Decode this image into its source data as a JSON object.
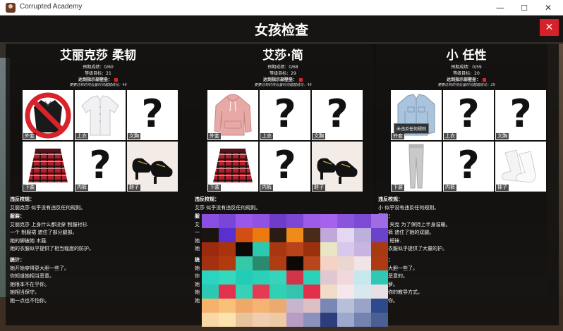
{
  "window": {
    "title": "Corrupted Academy",
    "minimize": "—",
    "maximize": "☐",
    "close": "✕"
  },
  "page": {
    "title": "女孩检查",
    "close_label": "✕"
  },
  "girls": [
    {
      "name": "艾丽克莎 柔韧",
      "stats": [
        "预期成绩：0/60",
        "等级目标：21",
        "达到指示部壁垒：",
        "要要达到的将后量时间越越结论：46"
      ],
      "slots": [
        {
          "label": "外套",
          "item": "banned-jacket",
          "question": ""
        },
        {
          "label": "上衣",
          "item": "white-shirt",
          "question": ""
        },
        {
          "label": "文胸",
          "item": "unknown",
          "question": "?"
        },
        {
          "label": "下装",
          "item": "plaid-skirt",
          "question": ""
        },
        {
          "label": "内裤",
          "item": "unknown",
          "question": "?"
        },
        {
          "label": "鞋子",
          "item": "mary-jane-shoes",
          "question": ""
        }
      ],
      "violation_title": "违反校规：",
      "violation_text": "艾丽克莎 似乎没有违反任何规则。",
      "outfit_title": "服装：",
      "outfit_lines": [
        "艾丽克莎 上身什么都没穿 制服衬衫.",
        "一个 制服裙 遮住了部分腿部。",
        "她的脚被她 木屐.",
        "她的衣服似乎提供了相当程度的防护。"
      ],
      "stats_title": "统计：",
      "stats_lines": [
        "她开始穿得更大胆一些了。",
        "你知道她相当恶意。",
        "她根本不在乎你。",
        "她相当保守。",
        "她一点也不怕你。"
      ]
    },
    {
      "name": "艾莎·简",
      "stats": [
        "预期成绩：0/68",
        "等级目标：29",
        "达到指示部壁垒：",
        "要要达到的将后量时间越越结论：46"
      ],
      "slots": [
        {
          "label": "外套",
          "item": "pink-hoodie",
          "question": ""
        },
        {
          "label": "上衣",
          "item": "unknown",
          "question": "?"
        },
        {
          "label": "文胸",
          "item": "unknown",
          "question": "?"
        },
        {
          "label": "下装",
          "item": "plaid-skirt",
          "question": ""
        },
        {
          "label": "内裤",
          "item": "unknown",
          "question": "?"
        },
        {
          "label": "鞋子",
          "item": "mary-jane-shoes",
          "question": ""
        }
      ],
      "violation_title": "违反校规：",
      "violation_text": "艾莎 似乎没有违反任何规则。",
      "outfit_title": "服",
      "outfit_lines": [
        "艾",
        "一",
        "她",
        "她"
      ],
      "stats_title": "统",
      "stats_lines": [
        "她",
        "你",
        "她",
        "她",
        "她"
      ]
    },
    {
      "name": "小 任性",
      "stats": [
        "预期成绩：0/59",
        "等级目标：20",
        "达到指示部壁垒：",
        "要要达到的将后量时间越越结论：29"
      ],
      "slots": [
        {
          "label": "外套",
          "item": "denim-jacket",
          "question": ""
        },
        {
          "label": "上衣",
          "item": "unknown",
          "question": "?"
        },
        {
          "label": "文胸",
          "item": "unknown",
          "question": "?"
        },
        {
          "label": "下装",
          "item": "grey-leggings",
          "question": ""
        },
        {
          "label": "内裤",
          "item": "unknown",
          "question": "?"
        },
        {
          "label": "袜子",
          "item": "white-socks",
          "question": ""
        }
      ],
      "tooltip": "未违反任何规则",
      "violation_title": "违反校规：",
      "violation_text": "小 似乎没有违反任何规则。",
      "outfit_title": "服装：",
      "outfit_lines": [
        "一条 夹克 为了保持上半身温暖。",
        "打底裤 遮住了她的双腿。",
        "她的 短袜.",
        "她的衣服似乎提供了大量的护。"
      ],
      "stats_title": "统计：",
      "stats_lines": [
        "得更大胆一些了。",
        "相当恶意的。",
        "本就萝。",
        "接受你的教导方式。",
        "不怕你。"
      ]
    }
  ],
  "colors": {
    "close_button": "#d6202a",
    "panel_bg": "#0c0c0c",
    "title_text": "#ffffff"
  }
}
